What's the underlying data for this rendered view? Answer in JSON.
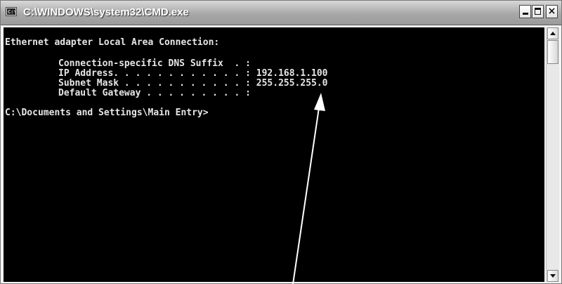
{
  "window": {
    "title": "C:\\WINDOWS\\system32\\CMD.exe",
    "icon": "console-app-icon",
    "icon_text": "C:\\",
    "minimize_icon": "minimize-icon",
    "maximize_icon": "maximize-icon",
    "close_label": "×"
  },
  "console": {
    "background": "#000000",
    "text_color": "#e6e6e6",
    "lines": {
      "adapter_header": "Ethernet adapter Local Area Connection:",
      "dns_suffix": "Connection-specific DNS Suffix  . :",
      "ip_address": "IP Address. . . . . . . . . . . . : 192.168.1.100",
      "subnet_mask": "Subnet Mask . . . . . . . . . . . : 255.255.255.0",
      "default_gateway": "Default Gateway . . . . . . . . . :",
      "prompt": "C:\\Documents and Settings\\Main Entry>"
    }
  },
  "scrollbar": {
    "up_icon": "scroll-up-arrow-icon",
    "down_icon": "scroll-down-arrow-icon"
  },
  "annotation": {
    "type": "arrow",
    "points_to": "default_gateway value",
    "color": "#ffffff"
  }
}
